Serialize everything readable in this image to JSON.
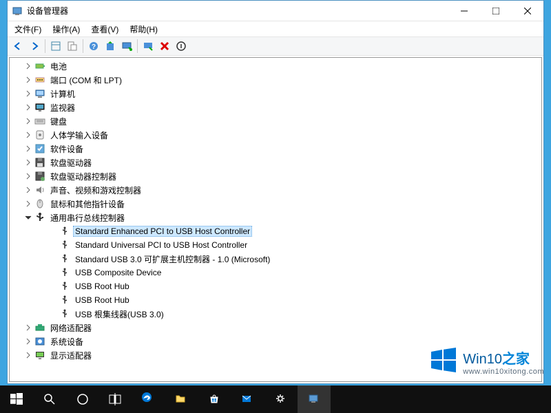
{
  "window": {
    "title": "设备管理器"
  },
  "menu": {
    "file": "文件(F)",
    "action": "操作(A)",
    "view": "查看(V)",
    "help": "帮助(H)"
  },
  "tree": {
    "nodes": [
      {
        "label": "电池",
        "icon": "battery",
        "indent": 1,
        "expand": ">"
      },
      {
        "label": "端口 (COM 和 LPT)",
        "icon": "port",
        "indent": 1,
        "expand": ">"
      },
      {
        "label": "计算机",
        "icon": "computer",
        "indent": 1,
        "expand": ">"
      },
      {
        "label": "监视器",
        "icon": "monitor",
        "indent": 1,
        "expand": ">"
      },
      {
        "label": "键盘",
        "icon": "keyboard",
        "indent": 1,
        "expand": ">"
      },
      {
        "label": "人体学输入设备",
        "icon": "hid",
        "indent": 1,
        "expand": ">"
      },
      {
        "label": "软件设备",
        "icon": "software",
        "indent": 1,
        "expand": ">"
      },
      {
        "label": "软盘驱动器",
        "icon": "floppy",
        "indent": 1,
        "expand": ">"
      },
      {
        "label": "软盘驱动器控制器",
        "icon": "floppy-ctrl",
        "indent": 1,
        "expand": ">"
      },
      {
        "label": "声音、视频和游戏控制器",
        "icon": "audio",
        "indent": 1,
        "expand": ">"
      },
      {
        "label": "鼠标和其他指针设备",
        "icon": "mouse",
        "indent": 1,
        "expand": ">"
      },
      {
        "label": "通用串行总线控制器",
        "icon": "usb-ctrl",
        "indent": 1,
        "expand": "v"
      },
      {
        "label": "Standard Enhanced PCI to USB Host Controller",
        "icon": "usb",
        "indent": 2,
        "expand": "",
        "selected": true
      },
      {
        "label": "Standard Universal PCI to USB Host Controller",
        "icon": "usb",
        "indent": 2,
        "expand": ""
      },
      {
        "label": "Standard USB 3.0 可扩展主机控制器 - 1.0 (Microsoft)",
        "icon": "usb",
        "indent": 2,
        "expand": ""
      },
      {
        "label": "USB Composite Device",
        "icon": "usb",
        "indent": 2,
        "expand": ""
      },
      {
        "label": "USB Root Hub",
        "icon": "usb",
        "indent": 2,
        "expand": ""
      },
      {
        "label": "USB Root Hub",
        "icon": "usb",
        "indent": 2,
        "expand": ""
      },
      {
        "label": "USB 根集线器(USB 3.0)",
        "icon": "usb",
        "indent": 2,
        "expand": ""
      },
      {
        "label": "网络适配器",
        "icon": "network",
        "indent": 1,
        "expand": ">"
      },
      {
        "label": "系统设备",
        "icon": "system",
        "indent": 1,
        "expand": ">"
      },
      {
        "label": "显示适配器",
        "icon": "display",
        "indent": 1,
        "expand": ">"
      }
    ]
  },
  "watermark": {
    "brand_a": "Win10",
    "brand_b": "之家",
    "url": "www.win10xitong.com"
  }
}
